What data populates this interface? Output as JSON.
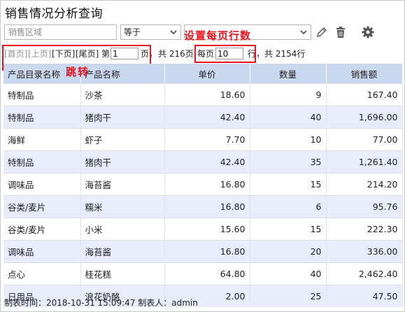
{
  "title": "销售情况分析查询",
  "filter": {
    "input_placeholder": "销售区域",
    "operator": "等于",
    "value": ""
  },
  "icons": {
    "edit": "pencil-icon",
    "delete": "trash-icon",
    "settings": "gear-icon"
  },
  "annotations": {
    "rows_per_page": "设置每页行数",
    "jump": "跳转"
  },
  "pager": {
    "first": "[首页]",
    "prev": "[上页]",
    "next": "[下页]",
    "last": "[尾页]",
    "page_prefix": "第",
    "page_value": "1",
    "page_suffix": "页，",
    "total_pages": "共 216页",
    "per_page_prefix": "每页",
    "per_page_value": "10",
    "per_page_suffix": "行，",
    "total_rows": "共 2154行"
  },
  "table": {
    "headers": [
      "产品目录名称",
      "产品名称",
      "单价",
      "数量",
      "销售额"
    ],
    "rows": [
      [
        "特制品",
        "沙茶",
        "18.60",
        "9",
        "167.40"
      ],
      [
        "特制品",
        "猪肉干",
        "42.40",
        "40",
        "1,696.00"
      ],
      [
        "海鲜",
        "虾子",
        "7.70",
        "10",
        "77.00"
      ],
      [
        "特制品",
        "猪肉干",
        "42.40",
        "35",
        "1,261.40"
      ],
      [
        "调味品",
        "海苔酱",
        "16.80",
        "15",
        "214.20"
      ],
      [
        "谷类/麦片",
        "糯米",
        "16.80",
        "6",
        "95.76"
      ],
      [
        "谷类/麦片",
        "小米",
        "15.60",
        "15",
        "222.30"
      ],
      [
        "调味品",
        "海苔酱",
        "16.80",
        "20",
        "336.00"
      ],
      [
        "点心",
        "桂花糕",
        "64.80",
        "40",
        "2,462.40"
      ],
      [
        "日用品",
        "浪花奶酪",
        "2.00",
        "25",
        "47.50"
      ]
    ]
  },
  "footer": "制表时间：2018-10-31 15:09:47 制表人：admin"
}
